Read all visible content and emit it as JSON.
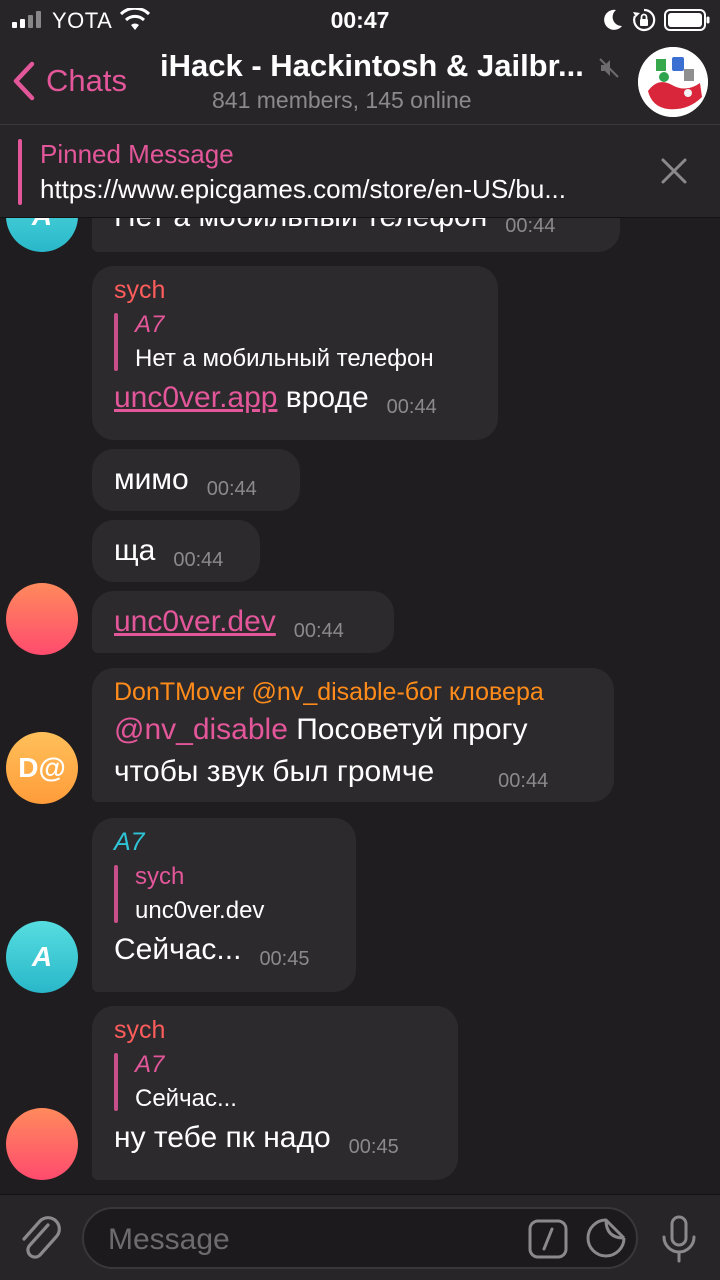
{
  "status_bar": {
    "carrier": "YOTA",
    "time": "00:47"
  },
  "header": {
    "back_label": "Chats",
    "title": "iHack - Hackintosh & Jailbr...",
    "subtitle": "841 members, 145 online"
  },
  "pinned": {
    "title": "Pinned Message",
    "text": "https://www.epicgames.com/store/en-US/bu..."
  },
  "messages": [
    {
      "text": "Нет а мобильный телефон",
      "time": "00:44"
    },
    {
      "sender": "sych",
      "reply_name": "A7",
      "reply_text": "Нет а мобильный телефон",
      "link": "unc0ver.app",
      "text": " вроде",
      "time": "00:44"
    },
    {
      "text": "мимо",
      "time": "00:44"
    },
    {
      "text": "ща",
      "time": "00:44"
    },
    {
      "link": "unc0ver.dev",
      "time": "00:44"
    },
    {
      "sender": "DonTMover @nv_disable-бог кловера",
      "mention": "@nv_disable",
      "text_line1": " Посоветуй прогу",
      "text_line2": "чтобы звук был громче",
      "time": "00:44",
      "avatar": "D@"
    },
    {
      "sender": "A7",
      "reply_name": "sych",
      "reply_text": "unc0ver.dev",
      "text": "Сейчас...",
      "time": "00:45",
      "avatar": "A"
    },
    {
      "sender": "sych",
      "reply_name": "A7",
      "reply_text": "Сейчас...",
      "text": "ну тебе пк надо",
      "time": "00:45"
    }
  ],
  "avatars": {
    "a7": "A"
  },
  "input": {
    "placeholder": "Message"
  },
  "colors": {
    "accent": "#e3579a",
    "sych_name": "#ff5c5c",
    "dontmover_name": "#ff8c1a",
    "a7_name": "#2ec4d6"
  }
}
